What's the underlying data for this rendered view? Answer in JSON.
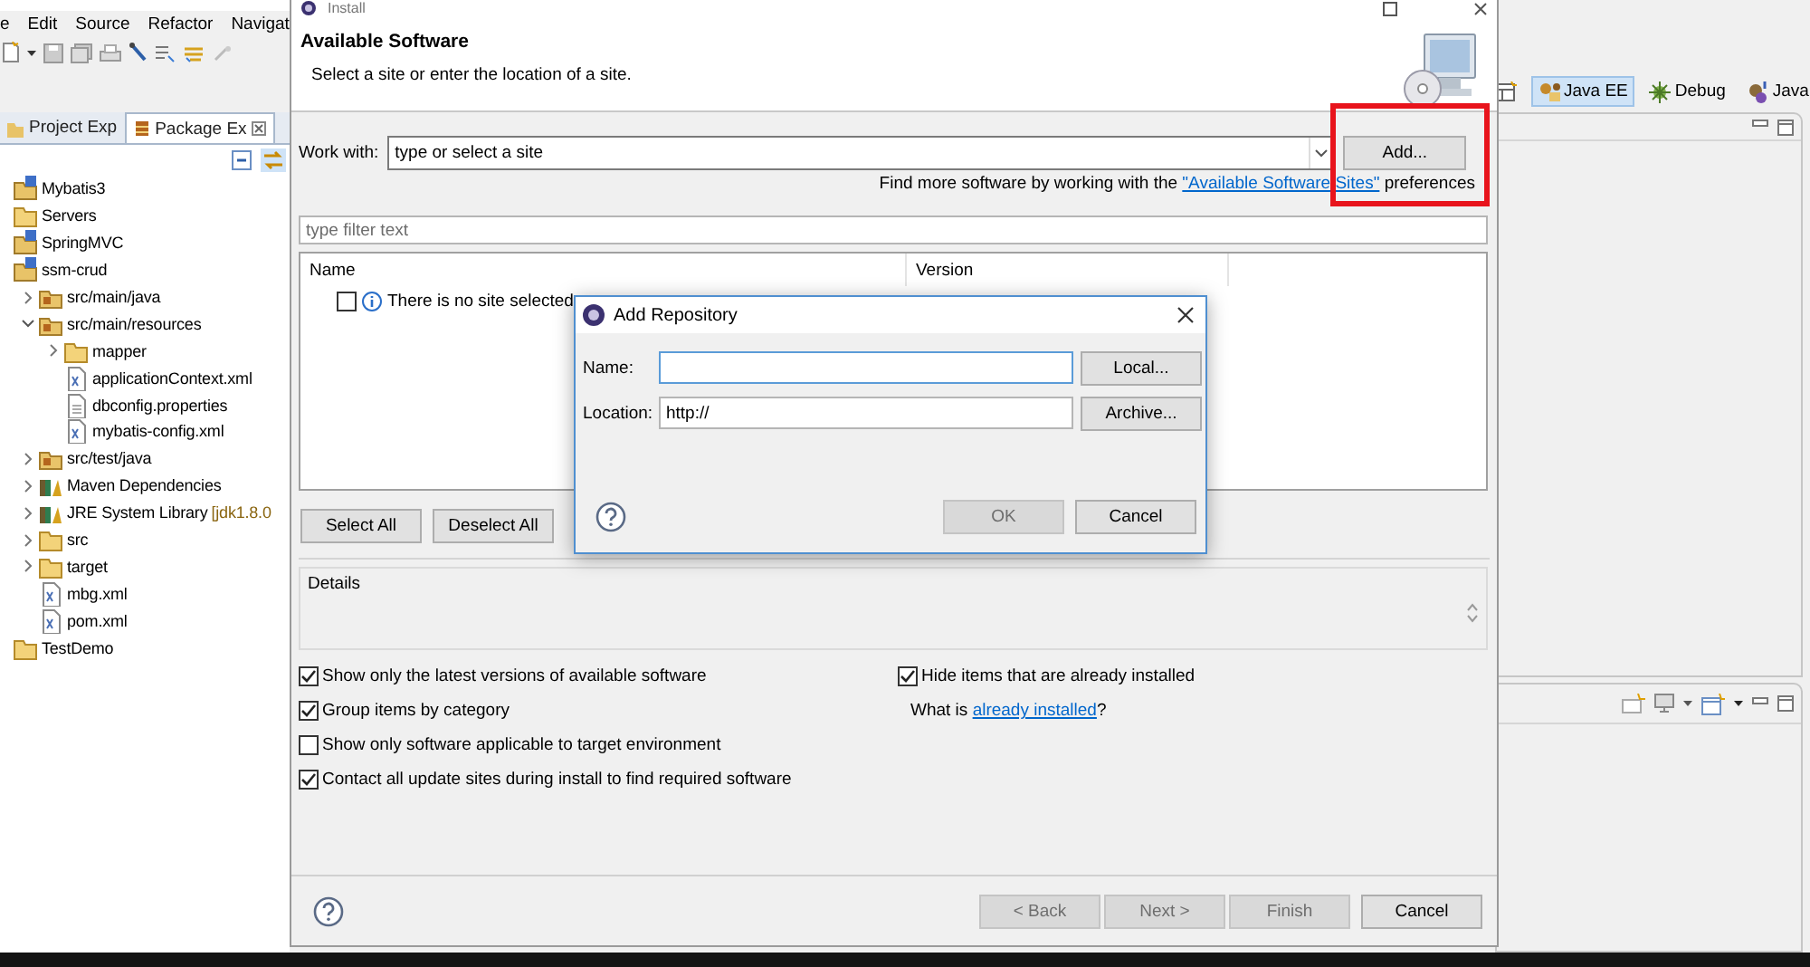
{
  "workbench": {
    "menu": [
      "e",
      "Edit",
      "Source",
      "Refactor",
      "Navigat"
    ],
    "view_tabs": [
      {
        "label": "Project Exp",
        "selected": false
      },
      {
        "label": "Package Ex",
        "selected": true
      }
    ],
    "tree": [
      {
        "label": "Mybatis3",
        "kind": "project"
      },
      {
        "label": "Servers",
        "kind": "folder"
      },
      {
        "label": "SpringMVC",
        "kind": "project"
      },
      {
        "label": "ssm-crud",
        "kind": "project",
        "children": [
          {
            "label": "src/main/java",
            "kind": "package",
            "expanded": false
          },
          {
            "label": "src/main/resources",
            "kind": "package",
            "expanded": true,
            "children": [
              {
                "label": "mapper",
                "kind": "folder",
                "expanded": false
              },
              {
                "label": "applicationContext.xml",
                "kind": "xml"
              },
              {
                "label": "dbconfig.properties",
                "kind": "file"
              },
              {
                "label": "mybatis-config.xml",
                "kind": "xml"
              }
            ]
          },
          {
            "label": "src/test/java",
            "kind": "package",
            "expanded": false
          },
          {
            "label": "Maven Dependencies",
            "kind": "library",
            "expanded": false
          },
          {
            "label": "JRE System Library",
            "decoration": "[jdk1.8.0",
            "kind": "library",
            "expanded": false
          },
          {
            "label": "src",
            "kind": "folder",
            "expanded": false
          },
          {
            "label": "target",
            "kind": "folder",
            "expanded": false
          },
          {
            "label": "mbg.xml",
            "kind": "xml"
          },
          {
            "label": "pom.xml",
            "kind": "xml"
          }
        ]
      },
      {
        "label": "TestDemo",
        "kind": "folder"
      }
    ],
    "perspectives": [
      {
        "label": "Java EE",
        "selected": true
      },
      {
        "label": "Debug",
        "selected": false
      },
      {
        "label": "Java",
        "selected": false
      }
    ]
  },
  "install_dialog": {
    "title": "Install",
    "heading": "Available Software",
    "subheading": "Select a site or enter the location of a site.",
    "work_with": {
      "label": "Work with:",
      "value": "type or select a site"
    },
    "add_button": {
      "label": "Add...",
      "highlighted": true
    },
    "sites_hint": {
      "before": "Find more software by working with the ",
      "link": "\"Available Software Sites\"",
      "after": " preferences"
    },
    "filter": {
      "placeholder": "type filter text"
    },
    "columns": [
      "Name",
      "Version"
    ],
    "rows": [
      {
        "label": "There is no site selected",
        "checked": false
      }
    ],
    "select_buttons": [
      "Select All",
      "Deselect All"
    ],
    "details_label": "Details",
    "left_options": [
      {
        "label": "Show only the latest versions of available software",
        "checked": true
      },
      {
        "label": "Group items by category",
        "checked": true
      },
      {
        "label": "Show only software applicable to target environment",
        "checked": false
      },
      {
        "label": "Contact all update sites during install to find required software",
        "checked": true
      }
    ],
    "right_options": [
      {
        "label": "Hide items that are already installed",
        "checked": true
      }
    ],
    "installed_hint": {
      "before": "What is ",
      "link": "already installed",
      "after": "?"
    },
    "buttons": [
      {
        "label": "< Back",
        "disabled": true
      },
      {
        "label": "Next >",
        "disabled": true
      },
      {
        "label": "Finish",
        "disabled": true
      },
      {
        "label": "Cancel",
        "disabled": false
      }
    ]
  },
  "add_repository": {
    "title": "Add Repository",
    "fields": [
      {
        "label": "Name:",
        "button": "Local..."
      },
      {
        "label": "Location:",
        "value": "http://",
        "button": "Archive..."
      }
    ],
    "buttons": [
      {
        "label": "OK",
        "disabled": true
      },
      {
        "label": "Cancel",
        "disabled": false
      }
    ]
  }
}
